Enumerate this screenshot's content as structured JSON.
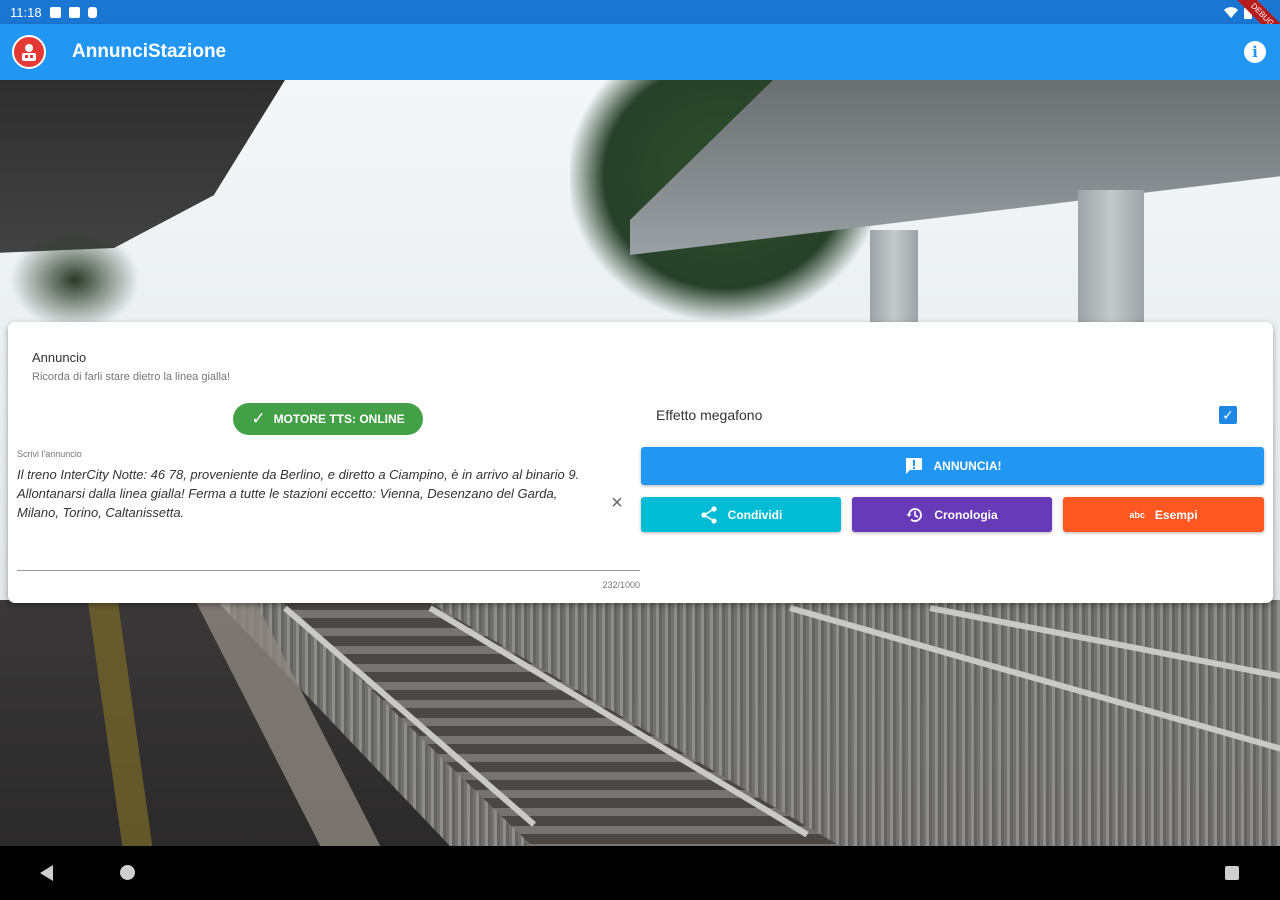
{
  "status_bar": {
    "time": "11:18",
    "debug_label": "DEBUG"
  },
  "app_bar": {
    "title": "AnnunciStazione"
  },
  "card": {
    "title": "Annuncio",
    "subtitle": "Ricorda di farli stare dietro la linea gialla!",
    "tts_status": "MOTORE TTS: ONLINE",
    "input": {
      "label": "Scrivi l'annuncio",
      "value": "Il treno InterCity Notte: 46 78, proveniente da Berlino, e diretto a Ciampino, è in arrivo al binario 9. Allontanarsi dalla linea gialla! Ferma a tutte le stazioni eccetto: Vienna, Desenzano del Garda, Milano, Torino, Caltanissetta.",
      "counter": "232/1000"
    },
    "megafono": {
      "label": "Effetto megafono",
      "checked": true
    },
    "buttons": {
      "annuncia": "ANNUNCIA!",
      "condividi": "Condividi",
      "cronologia": "Cronologia",
      "esempi": "Esempi",
      "esempi_icon_text": "abc"
    }
  },
  "colors": {
    "app_bar": "#2196f3",
    "status_bar": "#1976d2",
    "tts_online": "#43a047",
    "annuncia": "#2196f3",
    "condividi": "#00bcd4",
    "cronologia": "#673ab7",
    "esempi": "#ff5722"
  }
}
